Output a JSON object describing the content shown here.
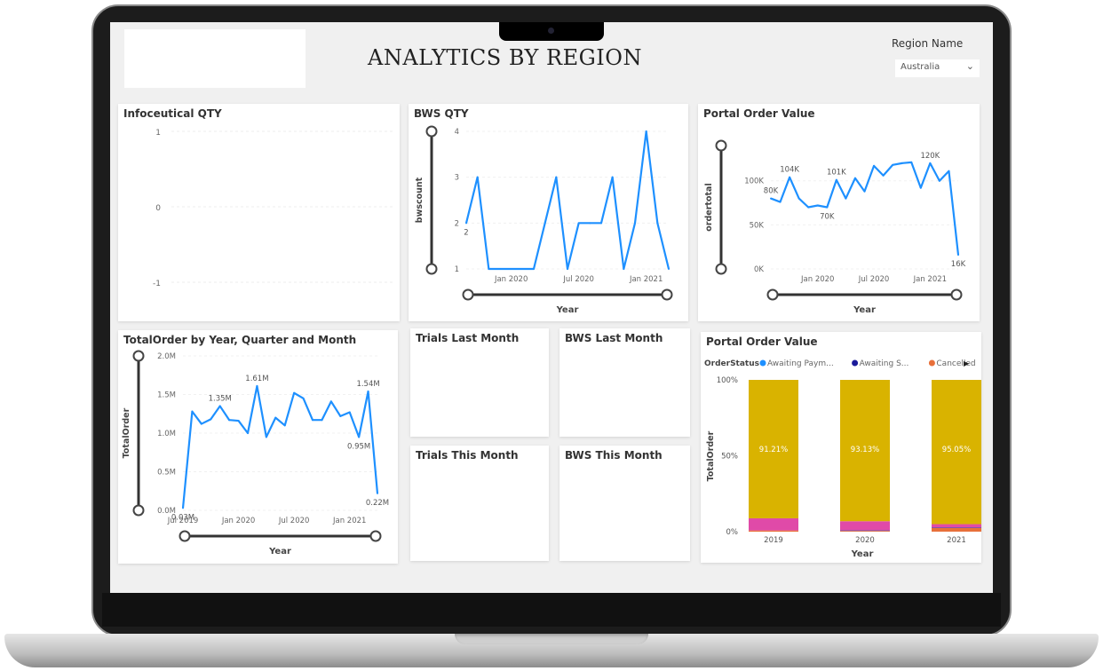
{
  "header": {
    "title": "ANALYTICS BY REGION",
    "region_label": "Region Name",
    "region_value": "Australia"
  },
  "cards": {
    "trials_last": "Trials Last Month",
    "bws_last": "BWS Last Month",
    "trials_this": "Trials This Month",
    "bws_this": "BWS This Month"
  },
  "colors": {
    "line": "#1e90ff",
    "yellow": "#d9b300",
    "pink": "#e04aa8",
    "purple": "#6b3fa0",
    "orange": "#e8703a"
  },
  "chart_data": [
    {
      "id": "info",
      "type": "line",
      "title": "Infoceutical QTY",
      "yticks": [
        "1",
        "0",
        "-1"
      ],
      "ylim": [
        -1,
        1
      ],
      "x": [],
      "values": []
    },
    {
      "id": "bws",
      "type": "line",
      "title": "BWS QTY",
      "ylabel": "bwscount",
      "xlabel": "Year",
      "x": [
        "Sep 2019",
        "Oct 2019",
        "Nov 2019",
        "Dec 2019",
        "Jan 2020",
        "Feb 2020",
        "Mar 2020",
        "Apr 2020",
        "May 2020",
        "Jun 2020",
        "Jul 2020",
        "Aug 2020",
        "Sep 2020",
        "Oct 2020",
        "Nov 2020",
        "Dec 2020",
        "Jan 2021",
        "Feb 2021",
        "Mar 2021"
      ],
      "values": [
        2,
        3,
        1,
        1,
        1,
        1,
        1,
        2,
        3,
        1,
        2,
        2,
        2,
        3,
        1,
        2,
        4,
        2,
        1
      ],
      "ylim": [
        1,
        4
      ],
      "yticks": [
        "1",
        "2",
        "3",
        "4"
      ],
      "xticks": [
        "Jan 2020",
        "Jul 2020",
        "Jan 2021"
      ],
      "data_labels": [
        {
          "i": 0,
          "t": "2"
        }
      ]
    },
    {
      "id": "pov",
      "type": "line",
      "title": "Portal Order Value",
      "ylabel": "ordertotal",
      "xlabel": "Year",
      "x": [
        "Aug 2019",
        "Sep 2019",
        "Oct 2019",
        "Nov 2019",
        "Dec 2019",
        "Jan 2020",
        "Feb 2020",
        "Mar 2020",
        "Apr 2020",
        "May 2020",
        "Jun 2020",
        "Jul 2020",
        "Aug 2020",
        "Sep 2020",
        "Oct 2020",
        "Nov 2020",
        "Dec 2020",
        "Jan 2021",
        "Feb 2021",
        "Mar 2021",
        "Apr 2021"
      ],
      "values": [
        80,
        76,
        104,
        80,
        70,
        72,
        70,
        101,
        80,
        103,
        88,
        117,
        106,
        118,
        120,
        121,
        92,
        120,
        100,
        111,
        16
      ],
      "ylim": [
        0,
        140
      ],
      "yticks": [
        "0K",
        "50K",
        "100K"
      ],
      "ytick_values": [
        0,
        50,
        100
      ],
      "xticks": [
        "Jan 2020",
        "Jul 2020",
        "Jan 2021"
      ],
      "data_labels": [
        {
          "i": 0,
          "t": "80K"
        },
        {
          "i": 2,
          "t": "104K"
        },
        {
          "i": 6,
          "t": "70K"
        },
        {
          "i": 7,
          "t": "101K"
        },
        {
          "i": 17,
          "t": "120K"
        },
        {
          "i": 20,
          "t": "16K"
        }
      ]
    },
    {
      "id": "tot",
      "type": "line",
      "title": "TotalOrder by Year, Quarter and Month",
      "ylabel": "TotalOrder",
      "xlabel": "Year",
      "x": [
        "Jul 2019",
        "Aug 2019",
        "Sep 2019",
        "Oct 2019",
        "Nov 2019",
        "Dec 2019",
        "Jan 2020",
        "Feb 2020",
        "Mar 2020",
        "Apr 2020",
        "May 2020",
        "Jun 2020",
        "Jul 2020",
        "Aug 2020",
        "Sep 2020",
        "Oct 2020",
        "Nov 2020",
        "Dec 2020",
        "Jan 2021",
        "Feb 2021",
        "Mar 2021",
        "Apr 2021"
      ],
      "values": [
        0.03,
        1.28,
        1.12,
        1.18,
        1.35,
        1.17,
        1.16,
        1.0,
        1.61,
        0.95,
        1.2,
        1.1,
        1.52,
        1.45,
        1.17,
        1.17,
        1.41,
        1.22,
        1.27,
        0.95,
        1.54,
        0.22
      ],
      "ylim": [
        0,
        2
      ],
      "yticks": [
        "0.0M",
        "0.5M",
        "1.0M",
        "1.5M",
        "2.0M"
      ],
      "ytick_values": [
        0,
        0.5,
        1,
        1.5,
        2
      ],
      "xticks": [
        "Jul 2019",
        "Jan 2020",
        "Jul 2020",
        "Jan 2021"
      ],
      "data_labels": [
        {
          "i": 0,
          "t": "0.03M"
        },
        {
          "i": 4,
          "t": "1.35M"
        },
        {
          "i": 8,
          "t": "1.61M"
        },
        {
          "i": 19,
          "t": "0.95M"
        },
        {
          "i": 20,
          "t": "1.54M"
        },
        {
          "i": 21,
          "t": "0.22M"
        }
      ]
    },
    {
      "id": "stack",
      "type": "bar",
      "title": "Portal Order Value",
      "ylabel": "TotalOrder",
      "xlabel": "Year",
      "legend_title": "OrderStatus",
      "legend": [
        {
          "name": "Awaiting Paym...",
          "color": "#1e90ff"
        },
        {
          "name": "Awaiting S...",
          "color": "#1a1a9a"
        },
        {
          "name": "Cancelled",
          "color": "#e8703a"
        }
      ],
      "categories": [
        "2019",
        "2020",
        "2021"
      ],
      "series": [
        {
          "color": "#e8703a",
          "values": [
            0.8,
            0.5,
            2.4
          ]
        },
        {
          "color": "#6b3fa0",
          "values": [
            0,
            0.5,
            0.5
          ]
        },
        {
          "color": "#e04aa8",
          "values": [
            7.99,
            5.87,
            2.05
          ]
        },
        {
          "color": "#d9b300",
          "values": [
            91.21,
            93.13,
            95.05
          ]
        }
      ],
      "bar_labels": [
        "91.21%",
        "93.13%",
        "95.05%"
      ],
      "yticks": [
        "0%",
        "50%",
        "100%"
      ],
      "ylim": [
        0,
        100
      ]
    }
  ]
}
